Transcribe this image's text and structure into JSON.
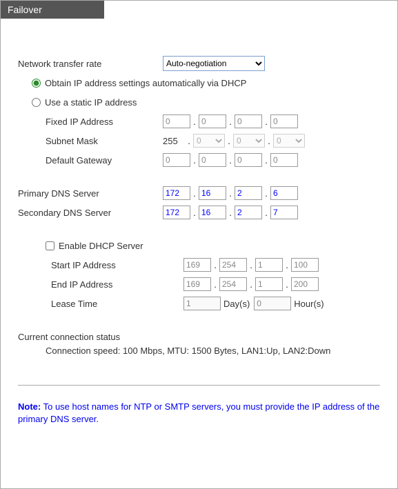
{
  "tab": {
    "label": "Failover"
  },
  "transfer": {
    "label": "Network transfer rate",
    "value": "Auto-negotiation"
  },
  "ipmode": {
    "dhcp_label": "Obtain IP address settings automatically via DHCP",
    "static_label": "Use a static IP address"
  },
  "static": {
    "fixed_label": "Fixed IP Address",
    "fixed": [
      "0",
      "0",
      "0",
      "0"
    ],
    "subnet_label": "Subnet Mask",
    "subnet_first": "255",
    "subnet_rest": [
      "0",
      "0",
      "0"
    ],
    "gateway_label": "Default Gateway",
    "gateway": [
      "0",
      "0",
      "0",
      "0"
    ]
  },
  "dns": {
    "primary_label": "Primary DNS Server",
    "primary": [
      "172",
      "16",
      "2",
      "6"
    ],
    "secondary_label": "Secondary DNS Server",
    "secondary": [
      "172",
      "16",
      "2",
      "7"
    ]
  },
  "dhcpserver": {
    "enable_label": "Enable DHCP Server",
    "start_label": "Start IP Address",
    "start": [
      "169",
      "254",
      "1",
      "100"
    ],
    "end_label": "End IP Address",
    "end": [
      "169",
      "254",
      "1",
      "200"
    ],
    "lease_label": "Lease Time",
    "days": "1",
    "days_unit": "Day(s)",
    "hours": "0",
    "hours_unit": "Hour(s)"
  },
  "status": {
    "title": "Current connection status",
    "text": "Connection speed: 100 Mbps, MTU: 1500 Bytes, LAN1:Up, LAN2:Down"
  },
  "note": {
    "prefix": "Note:",
    "text": " To use host names for NTP or SMTP servers, you must provide the IP address of the primary DNS server."
  }
}
